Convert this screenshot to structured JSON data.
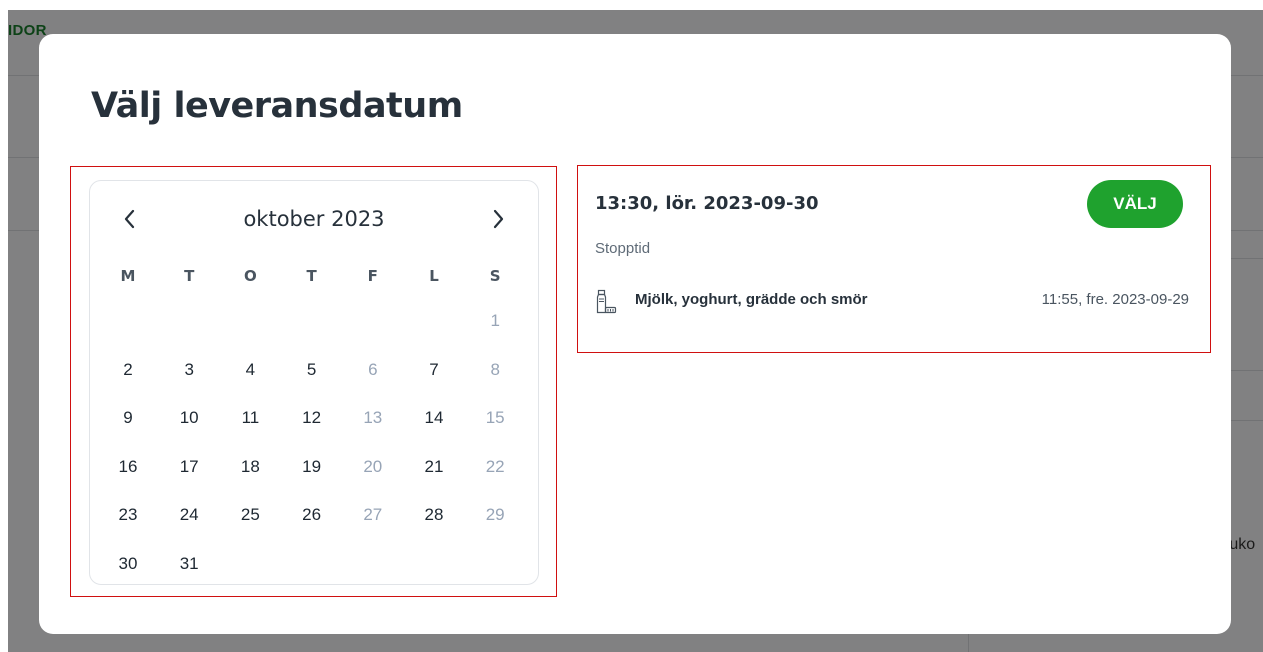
{
  "background": {
    "brand_fragment": "IDOR",
    "side_text_fragment": "ruko"
  },
  "modal": {
    "title": "Välj leveransdatum"
  },
  "calendar": {
    "month_label": "oktober 2023",
    "prev_icon": "chevron-left-icon",
    "next_icon": "chevron-right-icon",
    "weekday_headers": [
      "M",
      "T",
      "O",
      "T",
      "F",
      "L",
      "S"
    ],
    "weeks": [
      [
        "",
        "",
        "",
        "",
        "",
        "",
        "1"
      ],
      [
        "2",
        "3",
        "4",
        "5",
        "6",
        "7",
        "8"
      ],
      [
        "9",
        "10",
        "11",
        "12",
        "13",
        "14",
        "15"
      ],
      [
        "16",
        "17",
        "18",
        "19",
        "20",
        "21",
        "22"
      ],
      [
        "23",
        "24",
        "25",
        "26",
        "27",
        "28",
        "29"
      ],
      [
        "30",
        "31",
        "",
        "",
        "",
        "",
        ""
      ]
    ],
    "muted_columns": [
      "F",
      "S"
    ]
  },
  "delivery_slot": {
    "title": "13:30, lör. 2023-09-30",
    "select_label": "VÄLJ",
    "stop_label": "Stopptid",
    "items": [
      {
        "icon": "dairy-carton-icon",
        "category": "Mjölk, yoghurt, grädde och smör",
        "deadline": "11:55, fre. 2023-09-29"
      }
    ]
  },
  "colors": {
    "accent_green": "#1fa22e",
    "muted_date": "#97a4b6",
    "highlight_border": "#d01010",
    "text_dark": "#27313b"
  }
}
